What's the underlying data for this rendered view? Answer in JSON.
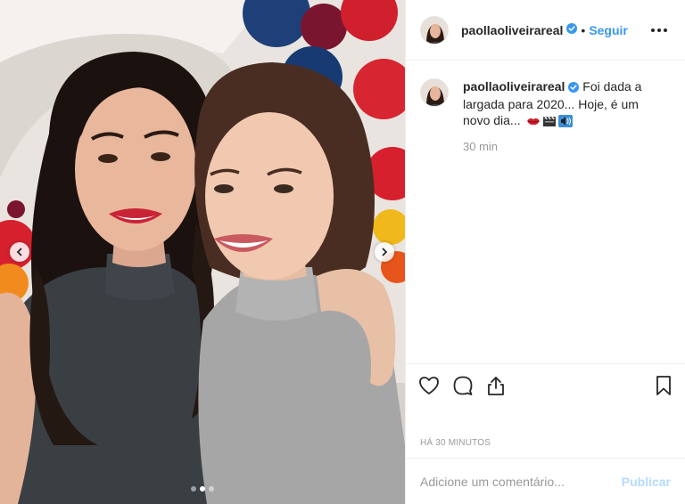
{
  "post": {
    "username": "paollaoliveirareal",
    "separator": "•",
    "follow_label": "Seguir",
    "caption": "Foi dada a largada para 2020... Hoje, é um novo dia...",
    "caption_time": "30 min",
    "timestamp": "HÁ 30 MINUTOS",
    "emojis": [
      "lips-icon",
      "clapperboard-icon",
      "speaker-icon"
    ]
  },
  "comment": {
    "placeholder": "Adicione um comentário...",
    "publish_label": "Publicar"
  },
  "carousel": {
    "count": 3,
    "active_index": 1
  },
  "colors": {
    "link_blue": "#3897f0",
    "publish_disabled": "#b3dbff",
    "verified_blue": "#3897f0",
    "muted_text": "#999999",
    "border": "#efefef"
  },
  "icons": {
    "like": "heart-icon",
    "comment": "comment-bubble-icon",
    "share": "share-icon",
    "save": "bookmark-icon",
    "options": "more-options-icon",
    "prev": "chevron-left-icon",
    "next": "chevron-right-icon"
  }
}
